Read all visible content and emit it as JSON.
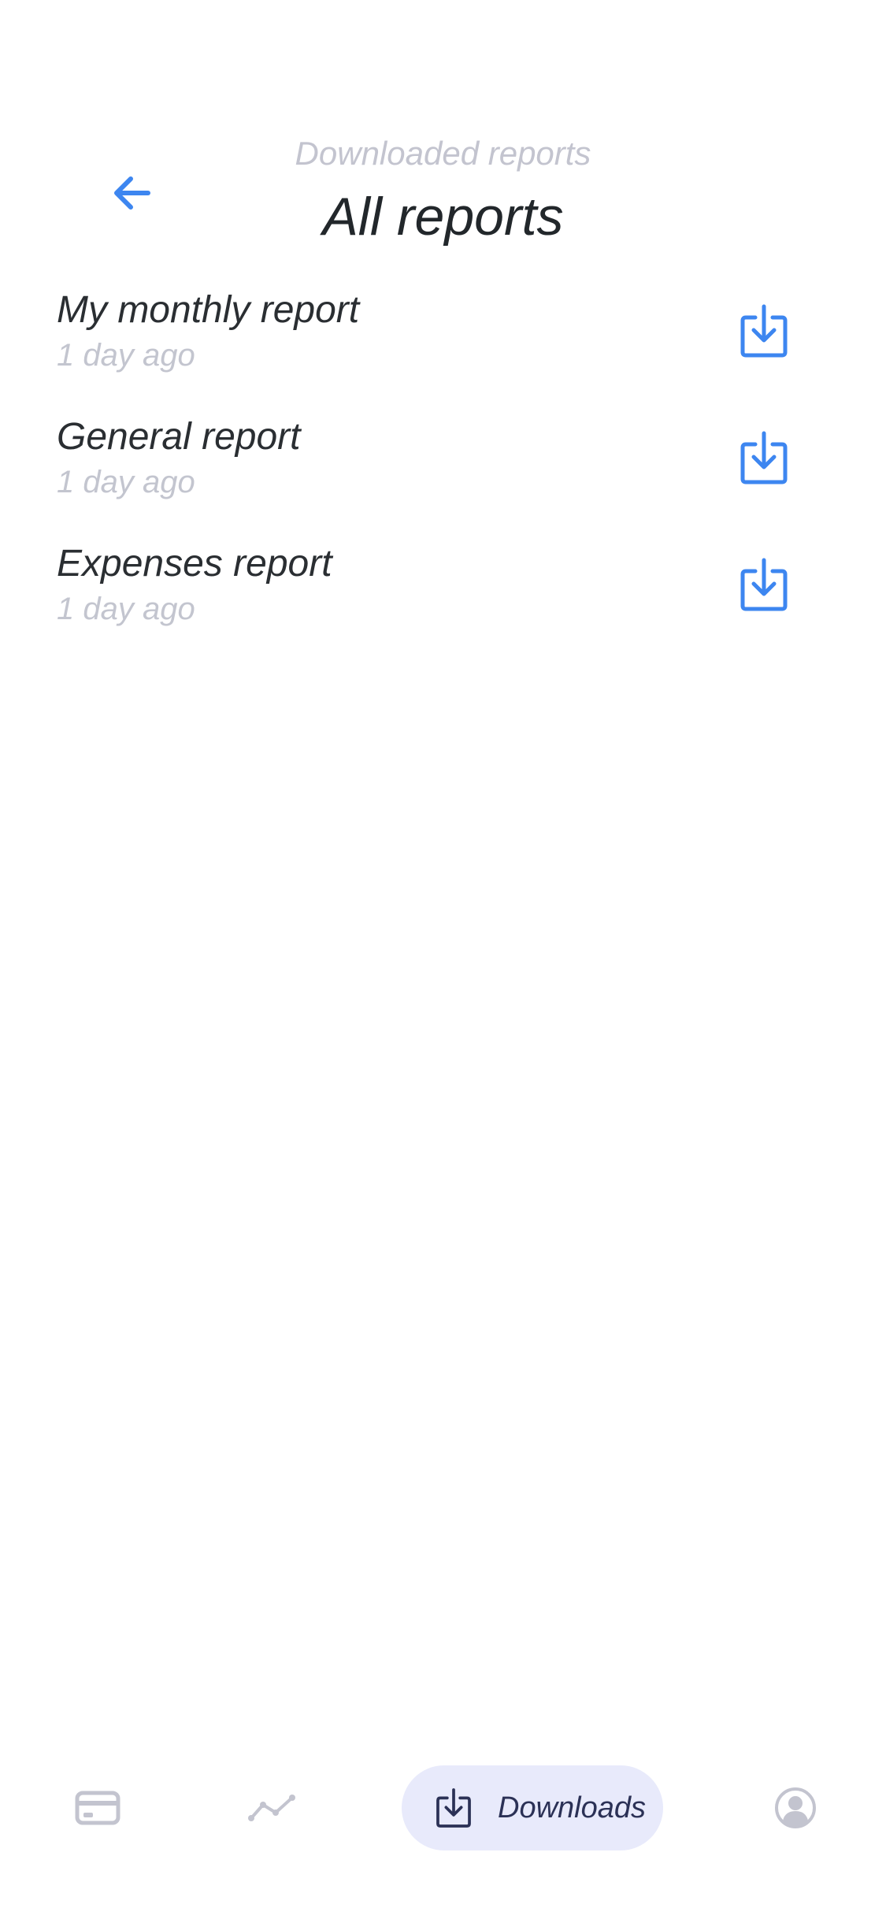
{
  "colors": {
    "accent": "#3d86f0",
    "title": "#22272b",
    "muted": "#c3c4cf",
    "nav_inactive": "#c3c4cf",
    "nav_active_bg": "#e8eafb",
    "nav_active_fg": "#2b3156"
  },
  "header": {
    "back_icon": "arrow-left-icon",
    "subtitle": "Downloaded reports",
    "title": "All reports"
  },
  "reports": [
    {
      "name": "My monthly report",
      "time": "1 day ago",
      "icon": "download-icon"
    },
    {
      "name": "General report",
      "time": "1 day ago",
      "icon": "download-icon"
    },
    {
      "name": "Expenses report",
      "time": "1 day ago",
      "icon": "download-icon"
    }
  ],
  "bottom_nav": {
    "items": [
      {
        "icon": "card-icon",
        "label": ""
      },
      {
        "icon": "analytics-icon",
        "label": ""
      },
      {
        "icon": "download-icon",
        "label": "Downloads",
        "active": true
      },
      {
        "icon": "profile-icon",
        "label": ""
      }
    ]
  }
}
